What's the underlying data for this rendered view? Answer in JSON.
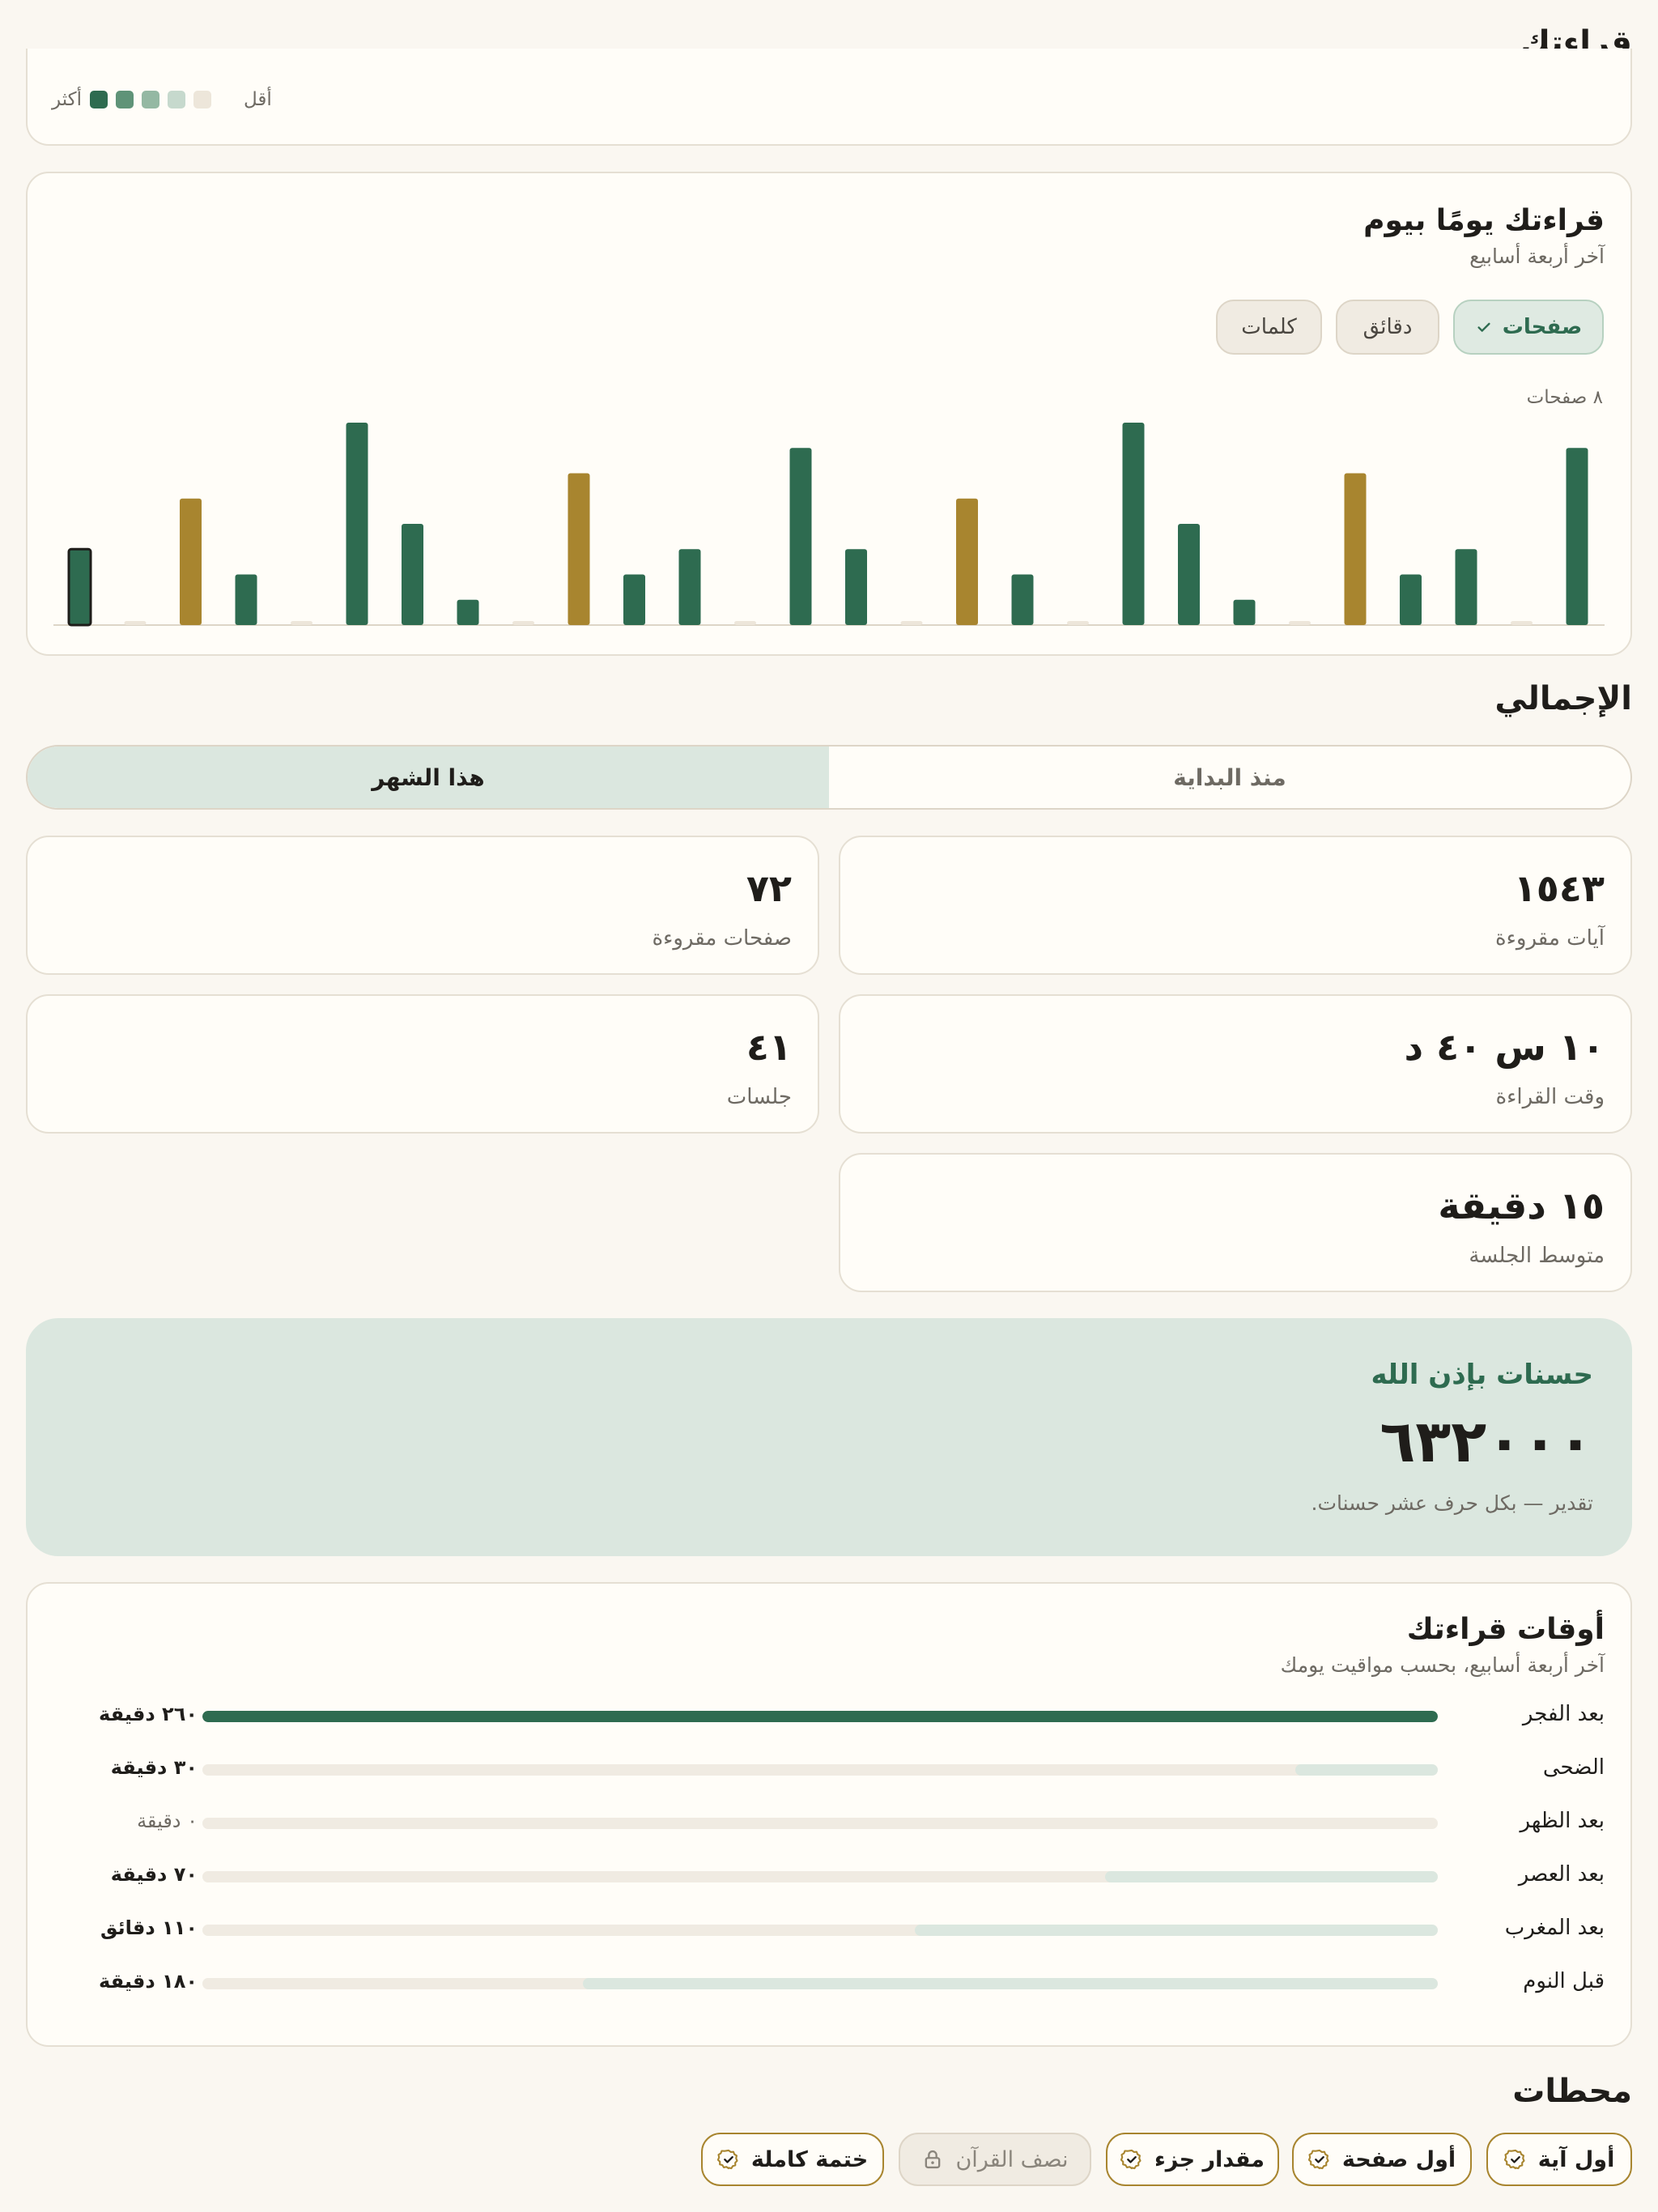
{
  "reading_section": {
    "title": "قراءتك",
    "legend": {
      "less": "أقل",
      "more": "أكثر",
      "colors": [
        "#ede6da",
        "#c6d9cd",
        "#94b8a3",
        "#5f9378",
        "#2e6b50"
      ]
    }
  },
  "daily": {
    "title": "قراءتك يومًا بيوم",
    "subtitle": "آخر أربعة أسابيع",
    "chips": [
      {
        "label": "صفحات",
        "active": true
      },
      {
        "label": "دقائق",
        "active": false
      },
      {
        "label": "كلمات",
        "active": false
      }
    ],
    "max_label": "٨ صفحات",
    "chart_data": {
      "type": "bar",
      "unit": "صفحات",
      "ylim": [
        0,
        8
      ],
      "order": "left-to-right = oldest-to-newest",
      "values": [
        3,
        0,
        5,
        2,
        0,
        8,
        4,
        1,
        0,
        6,
        2,
        3,
        0,
        7,
        3,
        0,
        5,
        2,
        0,
        8,
        4,
        1,
        0,
        6,
        2,
        3,
        0,
        7
      ],
      "highlight": [
        false,
        false,
        true,
        false,
        false,
        false,
        false,
        false,
        false,
        true,
        false,
        false,
        false,
        false,
        false,
        false,
        true,
        false,
        false,
        false,
        false,
        false,
        false,
        true,
        false,
        false,
        false,
        false
      ],
      "colors": {
        "normal": "#2e6b50",
        "highlight": "#a8852f",
        "empty": "#ede6da"
      }
    }
  },
  "totals": {
    "title": "الإجمالي",
    "tabs": [
      {
        "label": "هذا الشهر",
        "active": true
      },
      {
        "label": "منذ البداية",
        "active": false
      }
    ],
    "stats": [
      {
        "value": "١٥٤٣",
        "label": "آيات مقروءة"
      },
      {
        "value": "٧٢",
        "label": "صفحات مقروءة"
      },
      {
        "value": "١٠ س ٤٠ د",
        "label": "وقت القراءة"
      },
      {
        "value": "٤١",
        "label": "جلسات"
      },
      {
        "value": "١٥ دقيقة",
        "label": "متوسط الجلسة"
      }
    ]
  },
  "hasanat": {
    "title": "حسنات بإذن الله",
    "value": "٦٣٢٠٠٠",
    "note": "تقدير — بكل حرف عشر حسنات."
  },
  "times": {
    "title": "أوقات قراءتك",
    "subtitle": "آخر أربعة أسابيع، بحسب مواقيت يومك",
    "rows": [
      {
        "label": "بعد الفجر",
        "value_text": "٢٦٠ دقيقة",
        "minutes": 260
      },
      {
        "label": "الضحى",
        "value_text": "٣٠ دقيقة",
        "minutes": 30
      },
      {
        "label": "بعد الظهر",
        "value_text": "٠ دقيقة",
        "minutes": 0
      },
      {
        "label": "بعد العصر",
        "value_text": "٧٠ دقيقة",
        "minutes": 70
      },
      {
        "label": "بعد المغرب",
        "value_text": "١١٠ دقائق",
        "minutes": 110
      },
      {
        "label": "قبل النوم",
        "value_text": "١٨٠ دقيقة",
        "minutes": 180
      }
    ],
    "colors": {
      "max": "#2e6b50",
      "other": "#dbe7df",
      "track": "#f0ebe2"
    }
  },
  "milestones": {
    "title": "محطات",
    "badges": [
      {
        "label": "أول آية",
        "icon": "check-badge-icon",
        "locked": false
      },
      {
        "label": "أول صفحة",
        "icon": "check-badge-icon",
        "locked": false
      },
      {
        "label": "مقدار جزء",
        "icon": "check-badge-icon",
        "locked": false
      },
      {
        "label": "نصف القرآن",
        "icon": "lock-icon",
        "locked": true
      },
      {
        "label": "ختمة كاملة",
        "icon": "check-badge-icon",
        "locked": false
      }
    ]
  }
}
